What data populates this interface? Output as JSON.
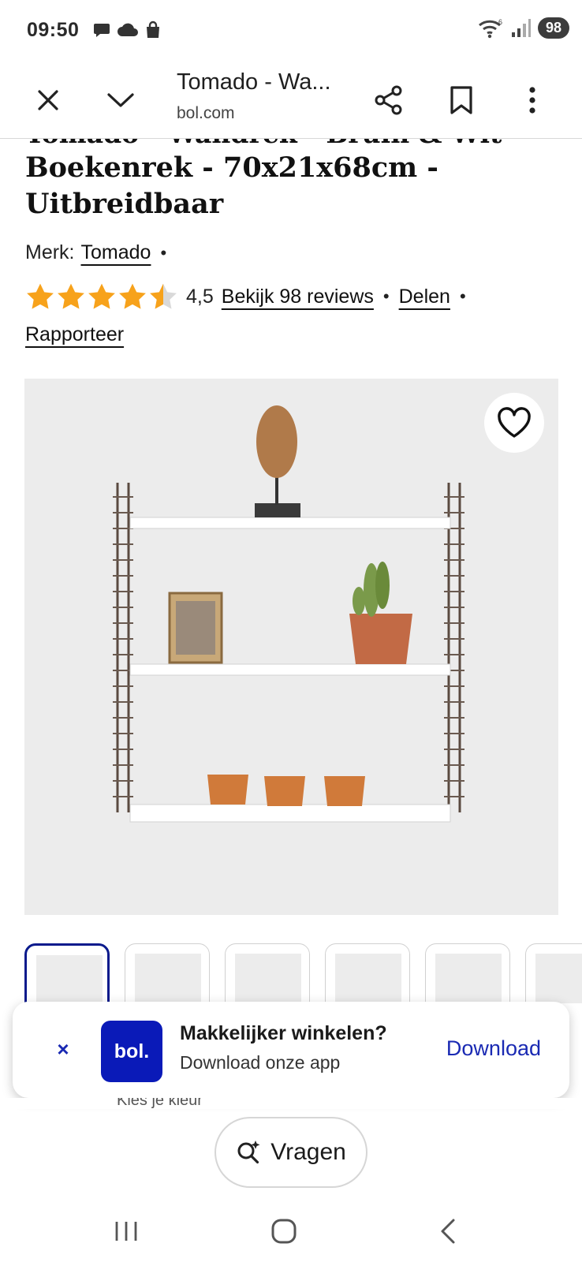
{
  "status_bar": {
    "time": "09:50",
    "left_icons": [
      "chat-icon",
      "cloud-icon",
      "shopping-bag-icon"
    ],
    "right_icons": [
      "wifi-icon",
      "signal-icon"
    ],
    "battery": "98"
  },
  "toolbar": {
    "title": "Tomado - Wa...",
    "domain": "bol.com",
    "icons": [
      "close-icon",
      "chevron-down-icon",
      "share-icon",
      "bookmark-icon",
      "more-vert-icon"
    ]
  },
  "product": {
    "title_clipped": "Tomado - Wandrek - Bruin & Wit",
    "title": "Boekenrek - 70x21x68cm - Uitbreidbaar",
    "brand_label": "Merk:",
    "brand": "Tomado",
    "rating": 4.5,
    "rating_text": "4,5",
    "reviews_link": "Bekijk 98 reviews",
    "share_link": "Delen",
    "report_link": "Rapporteer",
    "separator": "•"
  },
  "app_banner": {
    "close": "×",
    "logo": "bol.",
    "title": "Makkelijker winkelen?",
    "subtitle": "Download onze app",
    "action": "Download"
  },
  "peek_text": "Kies je kleur",
  "ask_button": {
    "label": "Vragen",
    "icon": "ai-search-icon"
  },
  "colors": {
    "brand_blue": "#0a1ab8",
    "star": "#f7a21b",
    "link_blue": "#1a2ab3"
  }
}
